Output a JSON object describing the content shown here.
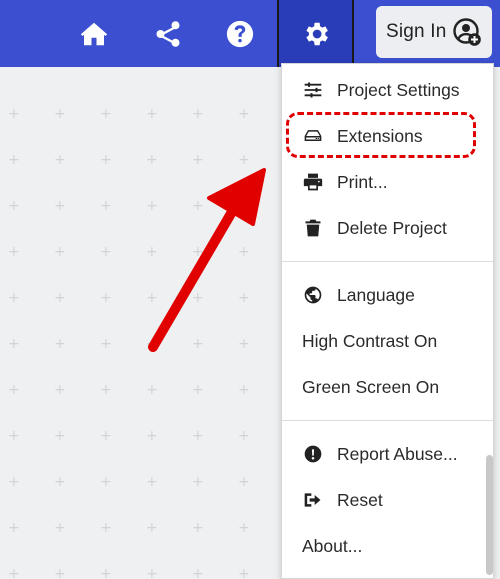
{
  "header": {
    "home_icon": "home-icon",
    "share_icon": "share-icon",
    "help_icon": "help-icon",
    "settings_icon": "gear-icon",
    "signin_label": "Sign In",
    "signin_icon": "account-plus-icon"
  },
  "menu": {
    "items": [
      {
        "label": "Project Settings",
        "icon": "sliders-icon"
      },
      {
        "label": "Extensions",
        "icon": "drive-icon"
      },
      {
        "label": "Print...",
        "icon": "printer-icon"
      },
      {
        "label": "Delete Project",
        "icon": "trash-icon"
      },
      {
        "label": "Language",
        "icon": "globe-icon"
      },
      {
        "label": "High Contrast On"
      },
      {
        "label": "Green Screen On"
      },
      {
        "label": "Report Abuse...",
        "icon": "alert-circle-icon"
      },
      {
        "label": "Reset",
        "icon": "sign-out-icon"
      },
      {
        "label": "About..."
      }
    ]
  },
  "colors": {
    "header_bg": "#3b4fd0",
    "settings_active_bg": "#2a3db8",
    "annotation": "#e10000"
  }
}
